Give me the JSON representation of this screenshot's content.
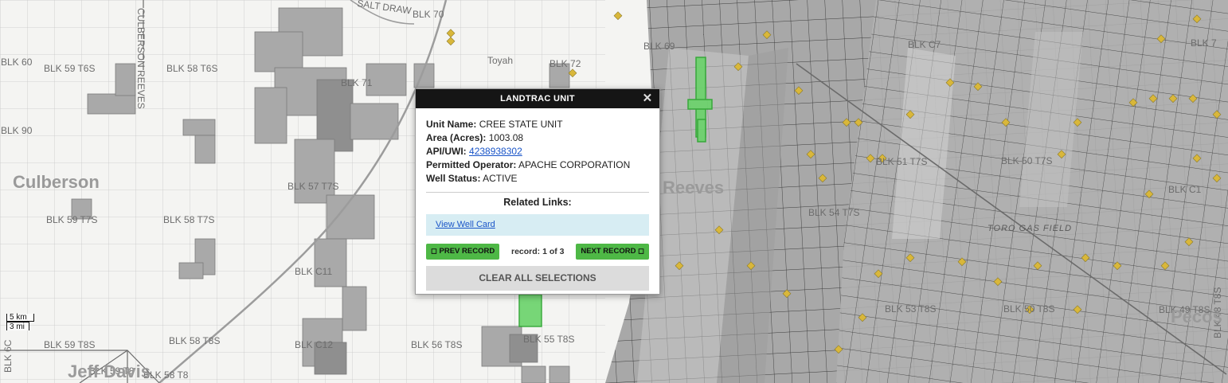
{
  "map": {
    "block_labels": [
      {
        "text": "BLK 70"
      },
      {
        "text": "BLK 60"
      },
      {
        "text": "BLK 59 T6S"
      },
      {
        "text": "BLK 58 T6S"
      },
      {
        "text": "BLK 71"
      },
      {
        "text": "BLK 72"
      },
      {
        "text": "BLK 90"
      },
      {
        "text": "BLK 57 T7S"
      },
      {
        "text": "BLK 59 T7S"
      },
      {
        "text": "BLK 58 T7S"
      },
      {
        "text": "BLK C11"
      },
      {
        "text": "BLK 59 T8S"
      },
      {
        "text": "BLK 58 T8S"
      },
      {
        "text": "BLK C12"
      },
      {
        "text": "BLK 56 T8S"
      },
      {
        "text": "BLK 55 T8S"
      },
      {
        "text": "BLK 54 T7S"
      },
      {
        "text": "BLK 51 T7S"
      },
      {
        "text": "BLK 50 T7S"
      },
      {
        "text": "BLK C7"
      },
      {
        "text": "BLK C1"
      },
      {
        "text": "BLK 53 T8S"
      },
      {
        "text": "BLK 50 T8S"
      },
      {
        "text": "BLK 49 T8S"
      },
      {
        "text": "BLK 48 T8S"
      },
      {
        "text": "BLK 6C"
      },
      {
        "text": "BLK 59 T8"
      },
      {
        "text": "BLK 58 T8"
      },
      {
        "text": "BLK 7"
      },
      {
        "text": "BLK 69"
      }
    ],
    "county_labels": [
      "Culberson",
      "Reeves",
      "Pecos",
      "Jeff Davis"
    ],
    "border_label": "CULBERSON REEVES",
    "town_label": "Toyah",
    "road_label": "SALT DRAW",
    "field_label": "TORO GAS FIELD",
    "colors": {
      "tract_fill": "#a9a9a9",
      "tract_dark": "#8f8f8f",
      "well_marker": "#d9b73a",
      "selected_unit": "#35c23c",
      "road": "#9c9c9c",
      "grid": "#bdbdbd"
    }
  },
  "scale": {
    "km": "5 km",
    "mi": "3 mi"
  },
  "popup": {
    "title": "LANDTRAC UNIT",
    "close_symbol": "✕",
    "attributes": [
      {
        "key": "Unit Name:",
        "value": "CREE STATE UNIT",
        "link": false
      },
      {
        "key": "Area (Acres):",
        "value": "1003.08",
        "link": false
      },
      {
        "key": "API/UWI:",
        "value": "4238938302",
        "link": true
      },
      {
        "key": "Permitted Operator:",
        "value": "APACHE CORPORATION",
        "link": false
      },
      {
        "key": "Well Status:",
        "value": "ACTIVE",
        "link": false
      }
    ],
    "related_title": "Related Links:",
    "related_link": "View Well Card",
    "prev_label": "◻ PREV RECORD",
    "record_text": "record: 1 of 3",
    "next_label": "NEXT RECORD ◻",
    "clear_label": "CLEAR ALL SELECTIONS"
  }
}
